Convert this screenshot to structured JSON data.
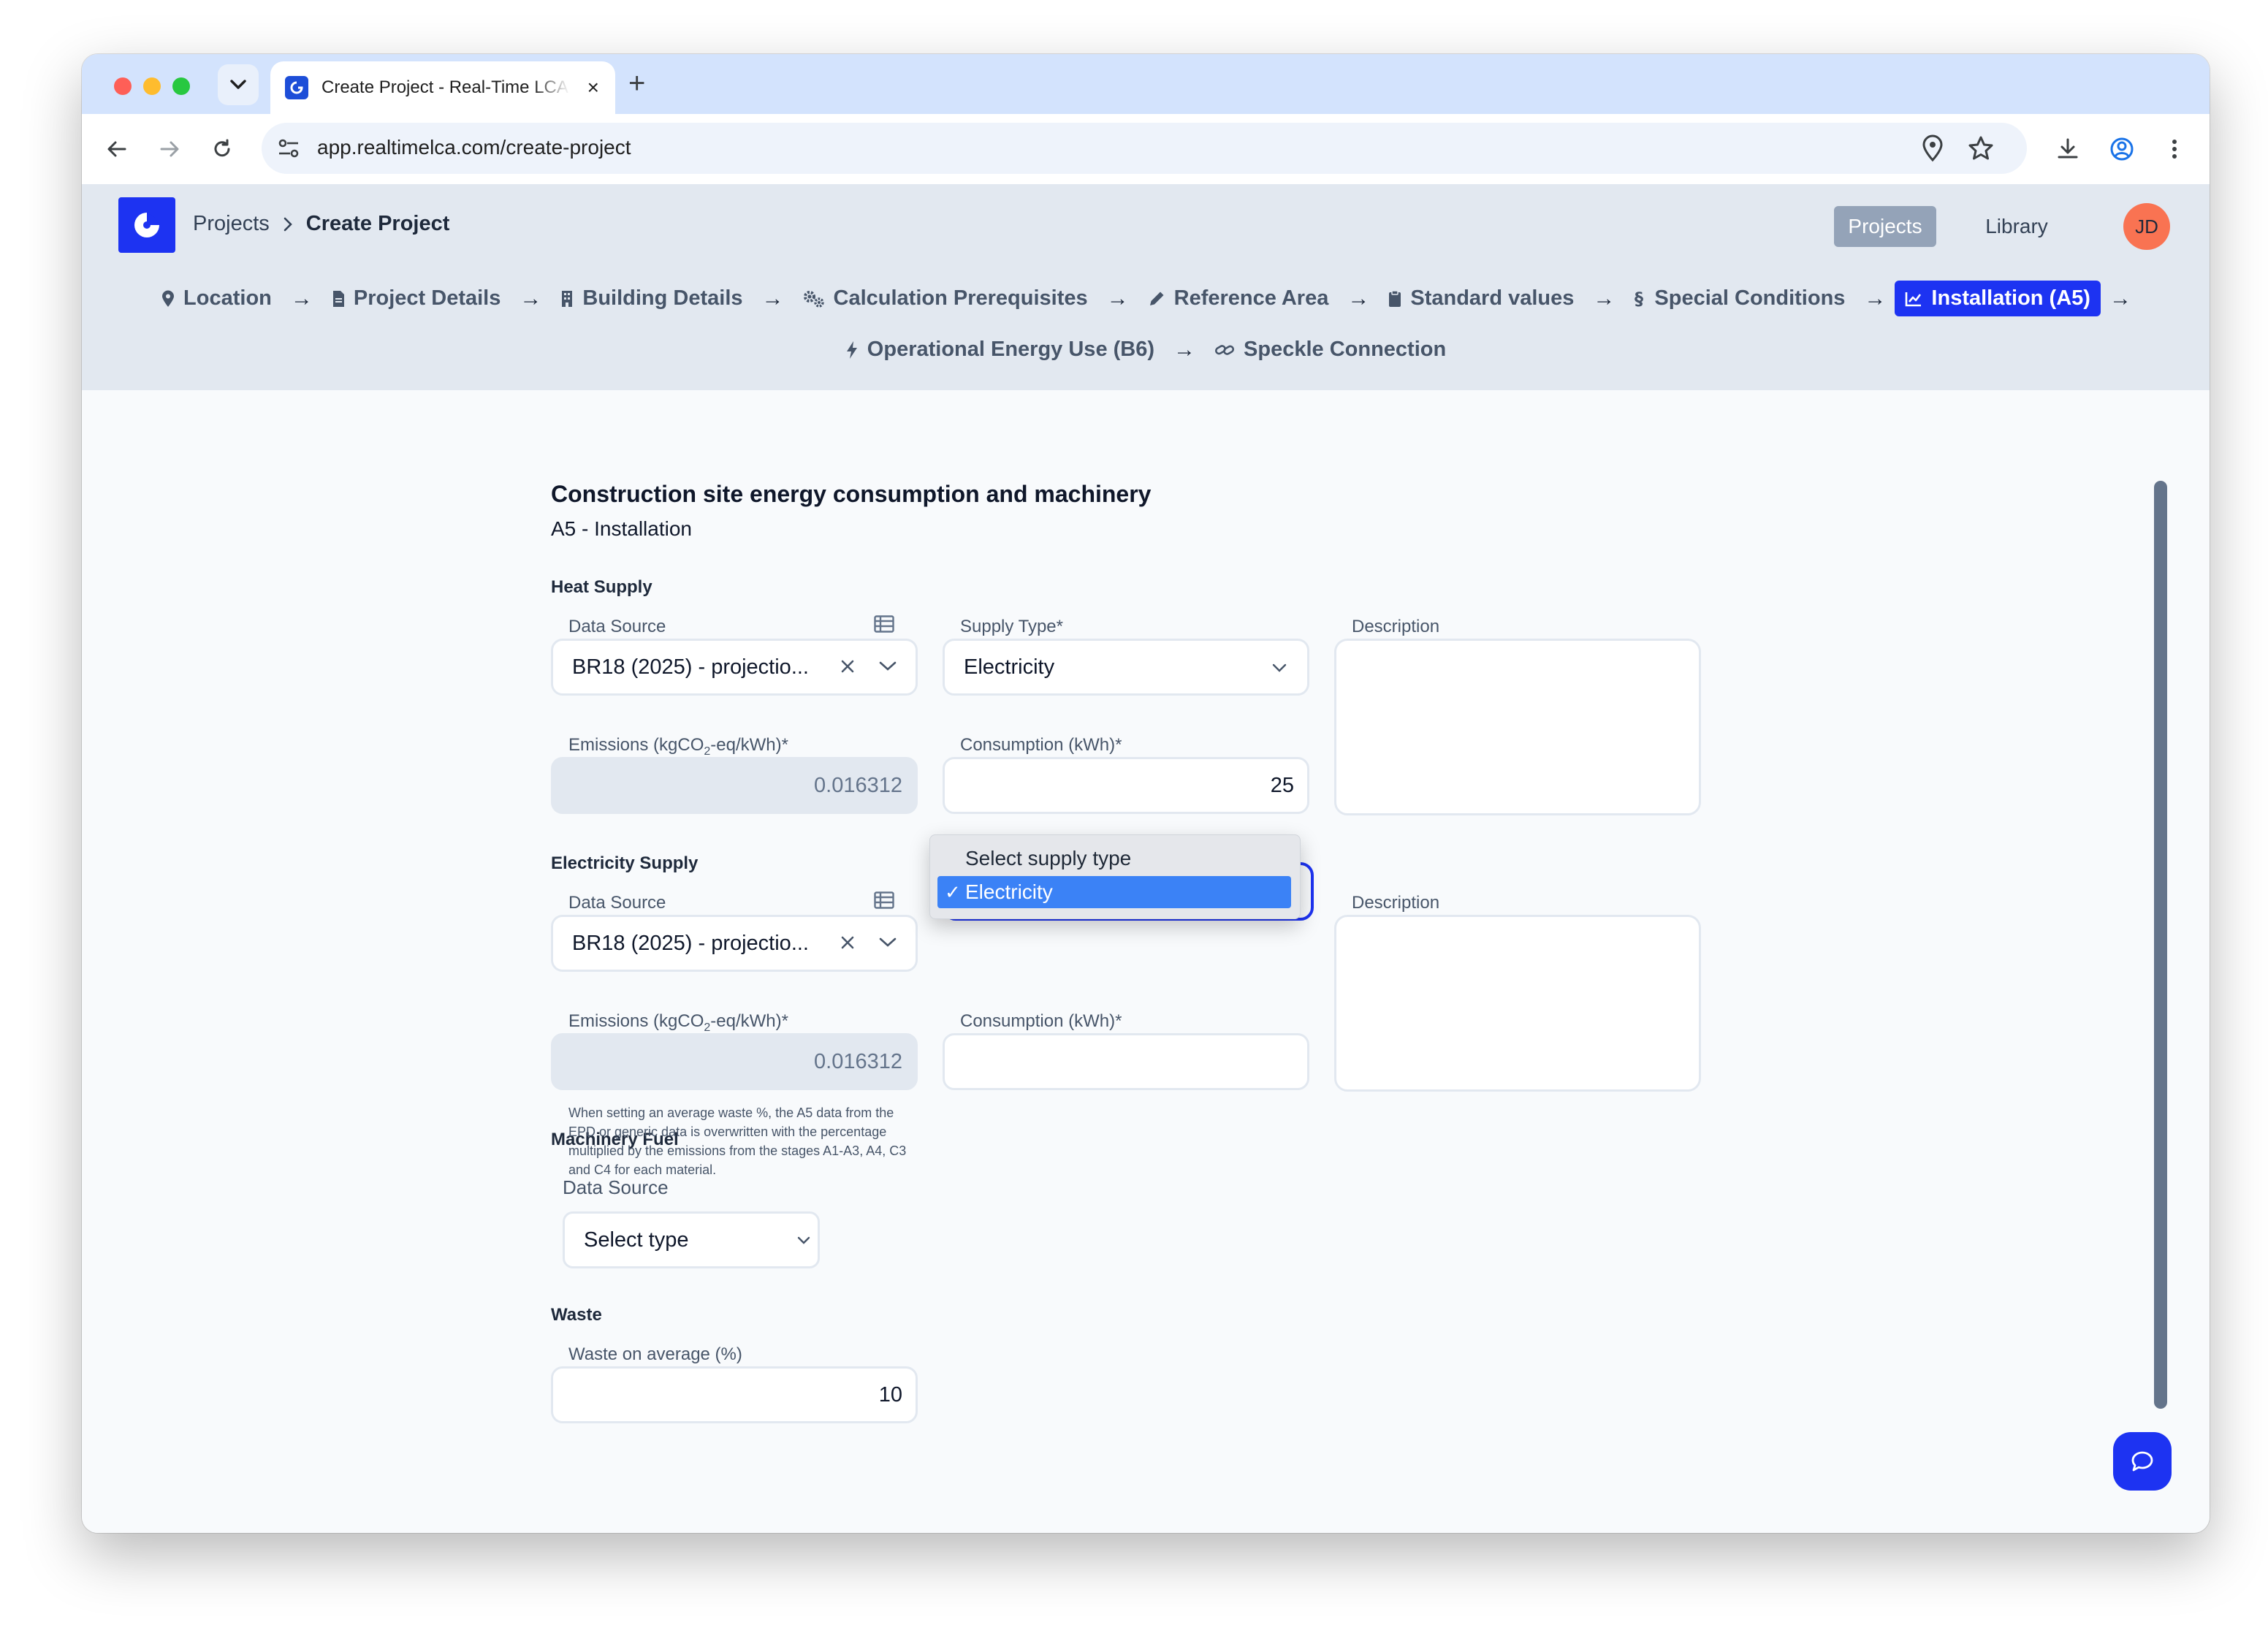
{
  "browser": {
    "tab_title": "Create Project - Real-Time LCA",
    "url": "app.realtimelca.com/create-project",
    "new_tab_label": "+",
    "tab_close_label": "×"
  },
  "header": {
    "breadcrumb": [
      "Projects",
      "Create Project"
    ],
    "nav": {
      "projects": "Projects",
      "library": "Library"
    },
    "avatar_initials": "JD"
  },
  "stepper": {
    "row1": [
      {
        "label": "Location",
        "icon": "map-pin-icon"
      },
      {
        "label": "Project Details",
        "icon": "document-icon"
      },
      {
        "label": "Building Details",
        "icon": "building-icon"
      },
      {
        "label": "Calculation Prerequisites",
        "icon": "cogs-icon"
      },
      {
        "label": "Reference Area",
        "icon": "pencil-icon"
      },
      {
        "label": "Standard values",
        "icon": "clipboard-icon"
      },
      {
        "label": "Special Conditions",
        "icon": "section-icon"
      },
      {
        "label": "Installation (A5)",
        "icon": "chart-line-icon",
        "active": true
      }
    ],
    "row2": [
      {
        "label": "Operational Energy Use (B6)",
        "icon": "bolt-icon"
      },
      {
        "label": "Speckle Connection",
        "icon": "link-icon"
      }
    ],
    "arrow": "→"
  },
  "page": {
    "title": "Construction site energy consumption and machinery",
    "subtitle": "A5 - Installation"
  },
  "heat": {
    "section": "Heat Supply",
    "data_source_label": "Data Source",
    "data_source_value": "BR18 (2025) - projectio...",
    "supply_type_label": "Supply Type*",
    "supply_type_value": "Electricity",
    "description_label": "Description",
    "emissions_label_pre": "Emissions (kgCO",
    "emissions_label_sub": "2",
    "emissions_label_post": "-eq/kWh)*",
    "emissions_value": "0.016312",
    "consumption_label": "Consumption (kWh)*",
    "consumption_value": "25"
  },
  "electricity": {
    "section": "Electricity Supply",
    "data_source_label": "Data Source",
    "data_source_value": "BR18 (2025) - projectio...",
    "description_label": "Description",
    "emissions_label_pre": "Emissions (kgCO",
    "emissions_label_sub": "2",
    "emissions_label_post": "-eq/kWh)*",
    "emissions_value": "0.016312",
    "consumption_label": "Consumption (kWh)*",
    "consumption_value": ""
  },
  "dropdown": {
    "options": [
      "Select supply type",
      "Electricity"
    ],
    "selected": "Electricity",
    "check": "✓"
  },
  "machinery": {
    "section": "Machinery Fuel",
    "data_source_label": "Data Source",
    "select_value": "Select type"
  },
  "waste": {
    "section": "Waste",
    "label": "Waste on average (%)",
    "value": "10",
    "helper": "When setting an average waste %, the A5 data from the EPD or generic data is overwritten with the percentage multiplied by the emissions from the stages A1-A3, A4, C3 and C4 for each material."
  },
  "colors": {
    "accent": "#1d33f2",
    "avatar": "#f97352",
    "header_bg": "#e2e8f0",
    "dropdown_selected": "#3b82f6"
  }
}
